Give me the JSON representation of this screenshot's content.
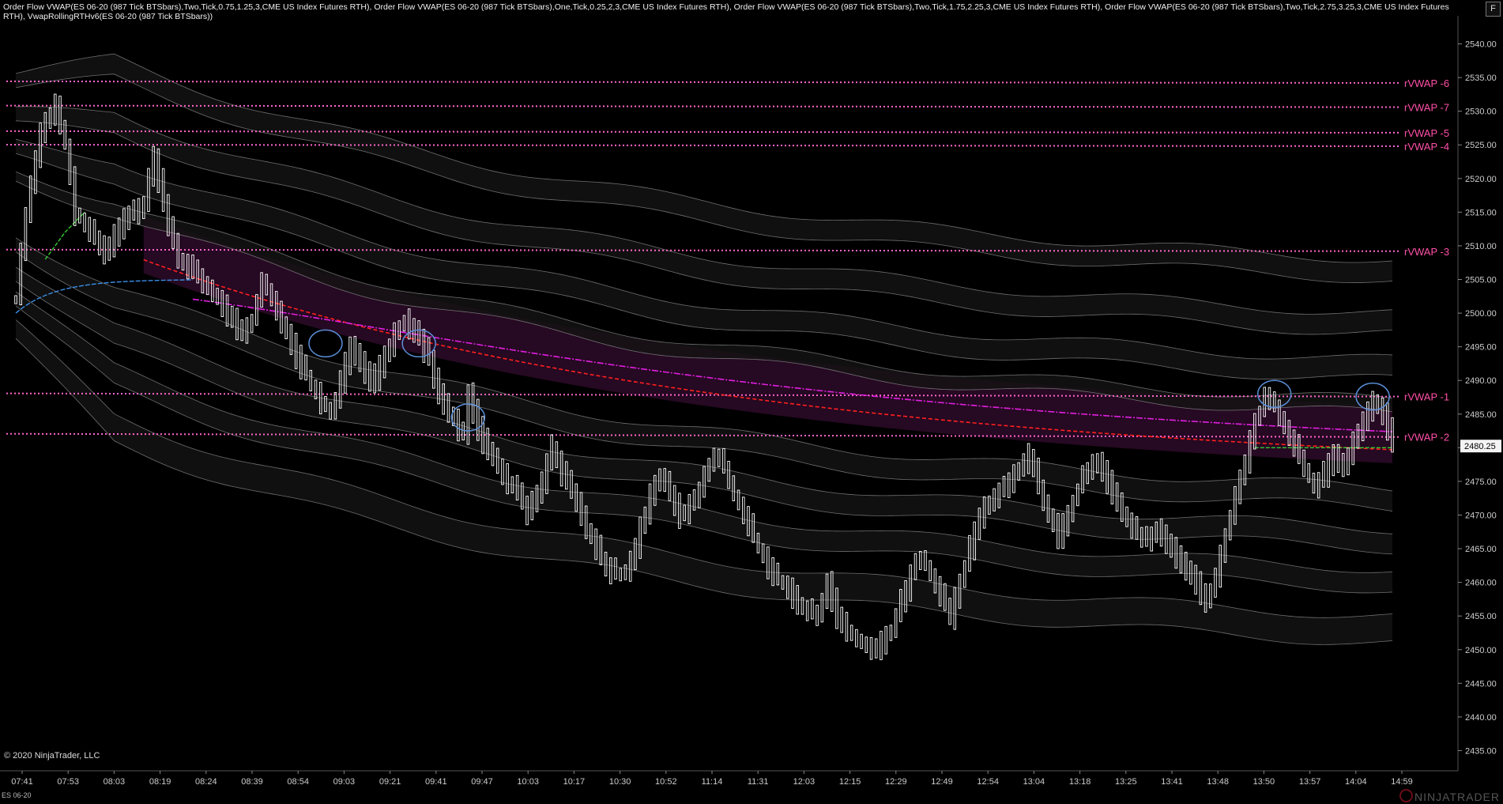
{
  "header": {
    "indicators_text": "Order Flow VWAP(ES 06-20 (987 Tick BTSbars),Two,Tick,0.75,1.25,3,CME US Index Futures RTH), Order Flow VWAP(ES 06-20 (987 Tick BTSbars),One,Tick,0.25,2,3,CME US Index Futures RTH), Order Flow VWAP(ES 06-20 (987 Tick BTSbars),Two,Tick,1.75,2.25,3,CME US Index Futures RTH), Order Flow VWAP(ES 06-20 (987 Tick BTSbars),Two,Tick,2.75,3.25,3,CME US Index Futures RTH), VwapRollingRTHv6(ES 06-20 (987 Tick BTSbars))",
    "corner_button": "F"
  },
  "footer": {
    "copyright": "© 2020 NinjaTrader, LLC",
    "instrument": "ES 06-20",
    "brand": "NINJATRADER"
  },
  "colors": {
    "background": "#000000",
    "price_bar": "#ffffff",
    "band_line": "#9a9a9a",
    "band_fill": "#141414",
    "rvwap_line": "#ff66cc",
    "rvwap_label": "#ff4fa8",
    "session_vwap": "#ff2020",
    "rolling_vwap": "#e020e0",
    "rolling_band_fill": "#2a0a26",
    "early_vwap": "#3a8ee6",
    "green_vwap": "#33cc33",
    "circle": "#5a8fd8",
    "axis_text": "#cccccc"
  },
  "chart_data": {
    "type": "candlestick",
    "instrument": "ES 06-20",
    "ylim": [
      2432,
      2543
    ],
    "y_ticks": [
      2540,
      2535,
      2530,
      2525,
      2520,
      2515,
      2510,
      2505,
      2500,
      2495,
      2490,
      2485,
      2480,
      2475,
      2470,
      2465,
      2460,
      2455,
      2450,
      2445,
      2440,
      2435
    ],
    "x_ticks": [
      "07:41",
      "07:53",
      "08:03",
      "08:19",
      "08:24",
      "08:39",
      "08:54",
      "09:03",
      "09:21",
      "09:41",
      "09:47",
      "10:03",
      "10:17",
      "10:30",
      "10:52",
      "11:14",
      "11:31",
      "12:03",
      "12:15",
      "12:29",
      "12:49",
      "12:54",
      "13:04",
      "13:18",
      "13:25",
      "13:41",
      "13:48",
      "13:50",
      "13:57",
      "14:04",
      "14:59"
    ],
    "last_price": "2480.25",
    "price_path": [
      [
        0,
        2502
      ],
      [
        2,
        2515
      ],
      [
        5,
        2527
      ],
      [
        8,
        2531
      ],
      [
        10,
        2525
      ],
      [
        12,
        2515
      ],
      [
        15,
        2512
      ],
      [
        18,
        2509
      ],
      [
        22,
        2514
      ],
      [
        26,
        2516
      ],
      [
        28,
        2523
      ],
      [
        30,
        2516
      ],
      [
        33,
        2508
      ],
      [
        36,
        2506
      ],
      [
        40,
        2503
      ],
      [
        43,
        2500
      ],
      [
        46,
        2497
      ],
      [
        48,
        2499
      ],
      [
        50,
        2505
      ],
      [
        52,
        2502
      ],
      [
        55,
        2497
      ],
      [
        58,
        2492
      ],
      [
        61,
        2488
      ],
      [
        64,
        2485
      ],
      [
        66,
        2490
      ],
      [
        68,
        2495
      ],
      [
        70,
        2493
      ],
      [
        72,
        2489
      ],
      [
        74,
        2492
      ],
      [
        77,
        2497
      ],
      [
        79,
        2499
      ],
      [
        82,
        2496
      ],
      [
        84,
        2493
      ],
      [
        86,
        2488
      ],
      [
        89,
        2484
      ],
      [
        91,
        2482
      ],
      [
        92,
        2488
      ],
      [
        94,
        2483
      ],
      [
        96,
        2479
      ],
      [
        99,
        2476
      ],
      [
        102,
        2473
      ],
      [
        104,
        2470
      ],
      [
        107,
        2475
      ],
      [
        109,
        2480
      ],
      [
        111,
        2476
      ],
      [
        114,
        2472
      ],
      [
        116,
        2468
      ],
      [
        118,
        2465
      ],
      [
        120,
        2462
      ],
      [
        123,
        2461
      ],
      [
        125,
        2463
      ],
      [
        127,
        2468
      ],
      [
        129,
        2473
      ],
      [
        131,
        2476
      ],
      [
        133,
        2473
      ],
      [
        135,
        2470
      ],
      [
        138,
        2472
      ],
      [
        140,
        2476
      ],
      [
        142,
        2479
      ],
      [
        144,
        2477
      ],
      [
        146,
        2473
      ],
      [
        148,
        2470
      ],
      [
        151,
        2465
      ],
      [
        154,
        2461
      ],
      [
        157,
        2459
      ],
      [
        160,
        2456
      ],
      [
        163,
        2455
      ],
      [
        165,
        2460
      ],
      [
        167,
        2455
      ],
      [
        170,
        2452
      ],
      [
        172,
        2451
      ],
      [
        174,
        2450
      ],
      [
        176,
        2451
      ],
      [
        178,
        2453
      ],
      [
        180,
        2457
      ],
      [
        182,
        2461
      ],
      [
        184,
        2464
      ],
      [
        186,
        2461
      ],
      [
        188,
        2458
      ],
      [
        190,
        2455
      ],
      [
        192,
        2460
      ],
      [
        194,
        2465
      ],
      [
        196,
        2470
      ],
      [
        198,
        2472
      ],
      [
        201,
        2474
      ],
      [
        204,
        2477
      ],
      [
        206,
        2479
      ],
      [
        208,
        2474
      ],
      [
        210,
        2470
      ],
      [
        212,
        2467
      ],
      [
        214,
        2470
      ],
      [
        216,
        2474
      ],
      [
        218,
        2477
      ],
      [
        220,
        2478
      ],
      [
        222,
        2475
      ],
      [
        224,
        2472
      ],
      [
        226,
        2469
      ],
      [
        228,
        2467
      ],
      [
        230,
        2466
      ],
      [
        232,
        2468
      ],
      [
        234,
        2466
      ],
      [
        236,
        2464
      ],
      [
        238,
        2462
      ],
      [
        240,
        2460
      ],
      [
        242,
        2457
      ],
      [
        244,
        2461
      ],
      [
        246,
        2467
      ],
      [
        248,
        2473
      ],
      [
        250,
        2478
      ],
      [
        252,
        2484
      ],
      [
        254,
        2487
      ],
      [
        256,
        2486
      ],
      [
        258,
        2483
      ],
      [
        260,
        2480
      ],
      [
        262,
        2477
      ],
      [
        264,
        2474
      ],
      [
        266,
        2476
      ],
      [
        268,
        2479
      ],
      [
        270,
        2477
      ],
      [
        272,
        2481
      ],
      [
        274,
        2484
      ],
      [
        276,
        2487
      ],
      [
        278,
        2485
      ],
      [
        280,
        2481
      ]
    ],
    "rolling_vwap_lines": [
      {
        "name": "rVWAP -6",
        "value": 2534.2
      },
      {
        "name": "rVWAP -7",
        "value": 2530.6
      },
      {
        "name": "rVWAP -5",
        "value": 2526.8
      },
      {
        "name": "rVWAP -4",
        "value": 2524.8
      },
      {
        "name": "rVWAP -3",
        "value": 2509.2
      },
      {
        "name": "rVWAP -1",
        "value": 2487.6
      },
      {
        "name": "rVWAP -2",
        "value": 2481.6
      }
    ]
  }
}
